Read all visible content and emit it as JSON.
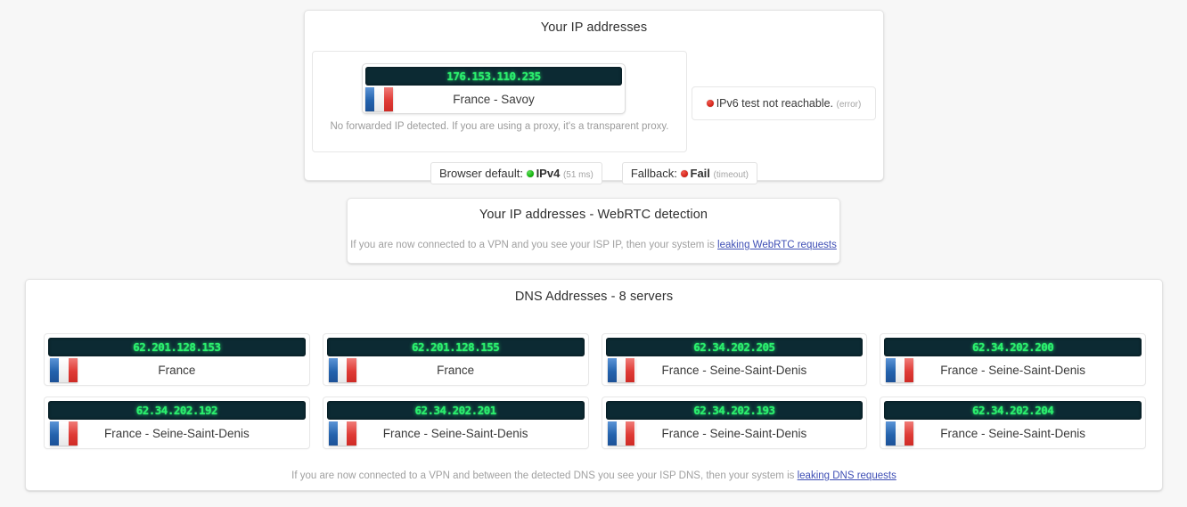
{
  "ip_section": {
    "title": "Your IP addresses",
    "primary": {
      "ip": "176.153.110.235",
      "location": "France - Savoy",
      "flag": "france-flag-icon"
    },
    "forwarded_note": "No forwarded IP detected. If you are using a proxy, it's a transparent proxy.",
    "ipv6": {
      "status_icon": "red-dot-icon",
      "message": "IPv6 test not reachable.",
      "detail": "(error)"
    },
    "status": {
      "browser_default_label": "Browser default:",
      "browser_default_value": "IPv4",
      "browser_default_detail": "(51 ms)",
      "browser_default_icon": "green-dot-icon",
      "fallback_label": "Fallback:",
      "fallback_value": "Fail",
      "fallback_detail": "(timeout)",
      "fallback_icon": "red-dot-icon"
    }
  },
  "webrtc_section": {
    "title": "Your IP addresses - WebRTC detection",
    "note_prefix": "If you are now connected to a VPN and you see your ISP IP, then your system is ",
    "note_link": "leaking WebRTC requests"
  },
  "dns_section": {
    "title": "DNS Addresses - 8 servers",
    "servers": [
      {
        "ip": "62.201.128.153",
        "location": "France",
        "flag": "france-flag-icon"
      },
      {
        "ip": "62.201.128.155",
        "location": "France",
        "flag": "france-flag-icon"
      },
      {
        "ip": "62.34.202.205",
        "location": "France - Seine-Saint-Denis",
        "flag": "france-flag-icon"
      },
      {
        "ip": "62.34.202.200",
        "location": "France - Seine-Saint-Denis",
        "flag": "france-flag-icon"
      },
      {
        "ip": "62.34.202.192",
        "location": "France - Seine-Saint-Denis",
        "flag": "france-flag-icon"
      },
      {
        "ip": "62.34.202.201",
        "location": "France - Seine-Saint-Denis",
        "flag": "france-flag-icon"
      },
      {
        "ip": "62.34.202.193",
        "location": "France - Seine-Saint-Denis",
        "flag": "france-flag-icon"
      },
      {
        "ip": "62.34.202.204",
        "location": "France - Seine-Saint-Denis",
        "flag": "france-flag-icon"
      }
    ],
    "note_prefix": "If you are now connected to a VPN and between the detected DNS you see your ISP DNS, then your system is ",
    "note_link": "leaking DNS requests"
  },
  "colors": {
    "page_background": "#f7f7f7",
    "card_background": "#ffffff",
    "led_background": "#0c2a33",
    "led_text": "#2bef6e",
    "link": "#3f4fb5",
    "status_ok": "#16b40f",
    "status_error": "#d7271c"
  }
}
